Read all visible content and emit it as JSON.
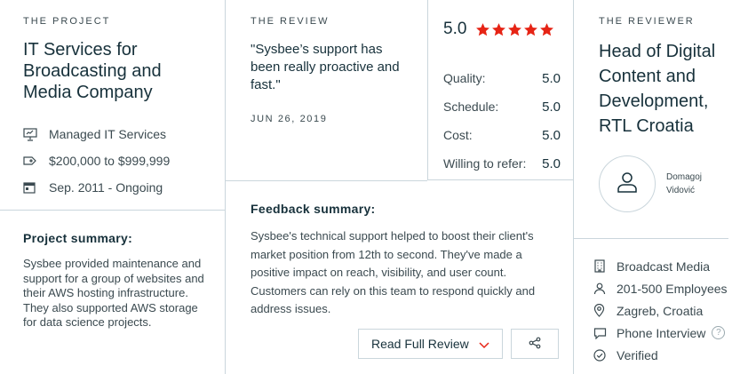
{
  "project": {
    "eyebrow": "THE PROJECT",
    "title": "IT Services for Broadcasting and Media Company",
    "meta": [
      {
        "icon": "presentation-board-icon",
        "text": "Managed IT Services"
      },
      {
        "icon": "price-tag-icon",
        "text": "$200,000 to $999,999"
      },
      {
        "icon": "calendar-icon",
        "text": "Sep. 2011 - Ongoing"
      }
    ],
    "summary_title": "Project summary:",
    "summary_text": "Sysbee provided maintenance and support for a group of websites and their AWS hosting infrastructure. They also supported AWS storage for data science projects."
  },
  "review": {
    "eyebrow": "THE REVIEW",
    "quote": "\"Sysbee’s support has been really proactive and fast.\"",
    "date": "JUN 26, 2019",
    "overall": "5.0",
    "stars": 5,
    "star_color": "#e62415",
    "ratings": [
      {
        "label": "Quality:",
        "value": "5.0"
      },
      {
        "label": "Schedule:",
        "value": "5.0"
      },
      {
        "label": "Cost:",
        "value": "5.0"
      },
      {
        "label": "Willing to refer:",
        "value": "5.0"
      }
    ],
    "feedback_title": "Feedback summary:",
    "feedback_text": "Sysbee's technical support helped to boost their client's market position from 12th to second. They've made a positive impact on reach, visibility, and user count. Customers can rely on this team to respond quickly and address issues.",
    "read_button": "Read Full Review",
    "accent_color": "#e62415"
  },
  "reviewer": {
    "eyebrow": "THE REVIEWER",
    "title": "Head of Digital Content and Development, RTL Croatia",
    "name_first": "Domagoj",
    "name_last": "Vidović",
    "meta": [
      {
        "icon": "building-icon",
        "text": "Broadcast Media"
      },
      {
        "icon": "user-icon",
        "text": "201-500 Employees"
      },
      {
        "icon": "location-pin-icon",
        "text": "Zagreb, Croatia"
      },
      {
        "icon": "chat-bubble-icon",
        "text": "Phone Interview",
        "help": "?"
      },
      {
        "icon": "check-circle-icon",
        "text": "Verified"
      }
    ]
  }
}
